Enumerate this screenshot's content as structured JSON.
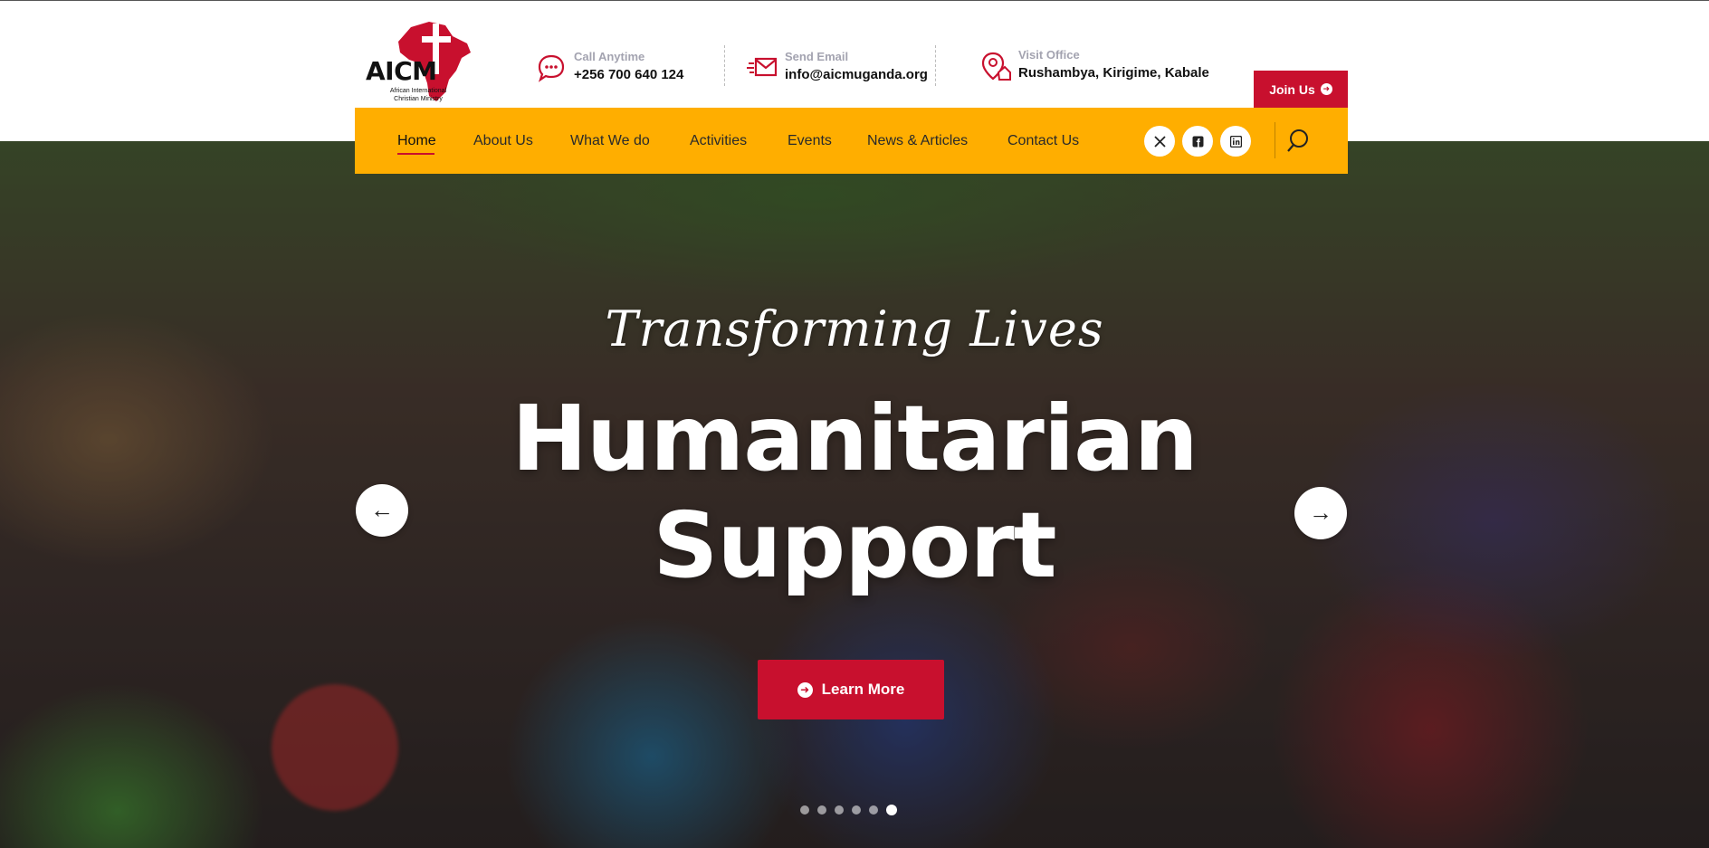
{
  "brand": {
    "name": "AICM",
    "tagline_line1": "African International",
    "tagline_line2": "Christian Ministry"
  },
  "contacts": [
    {
      "label": "Call Anytime",
      "value": "+256 700 640 124",
      "icon": "chat-bubble-icon"
    },
    {
      "label": "Send Email",
      "value": "info@aicmuganda.org",
      "icon": "envelope-icon"
    },
    {
      "label": "Visit Office",
      "value": "Rushambya, Kirigime, Kabale",
      "icon": "location-home-icon"
    }
  ],
  "join_button": {
    "label": "Join Us",
    "icon": "arrow-circle-right-icon"
  },
  "nav": {
    "items": [
      "Home",
      "About Us",
      "What We do",
      "Activities",
      "Events",
      "News & Articles",
      "Contact Us"
    ],
    "active": "Home",
    "social": [
      "twitter-icon",
      "facebook-icon",
      "linkedin-icon"
    ],
    "search_icon": "search-icon"
  },
  "hero": {
    "script_text": "Transforming Lives",
    "title_line1": "Humanitarian",
    "title_line2": "Support",
    "button_label": "Learn More",
    "prev_icon": "arrow-left-icon",
    "next_icon": "arrow-right-icon",
    "slide_count": 6,
    "active_slide": 6
  },
  "colors": {
    "accent_red": "#c8102e",
    "nav_yellow": "#ffae00"
  }
}
